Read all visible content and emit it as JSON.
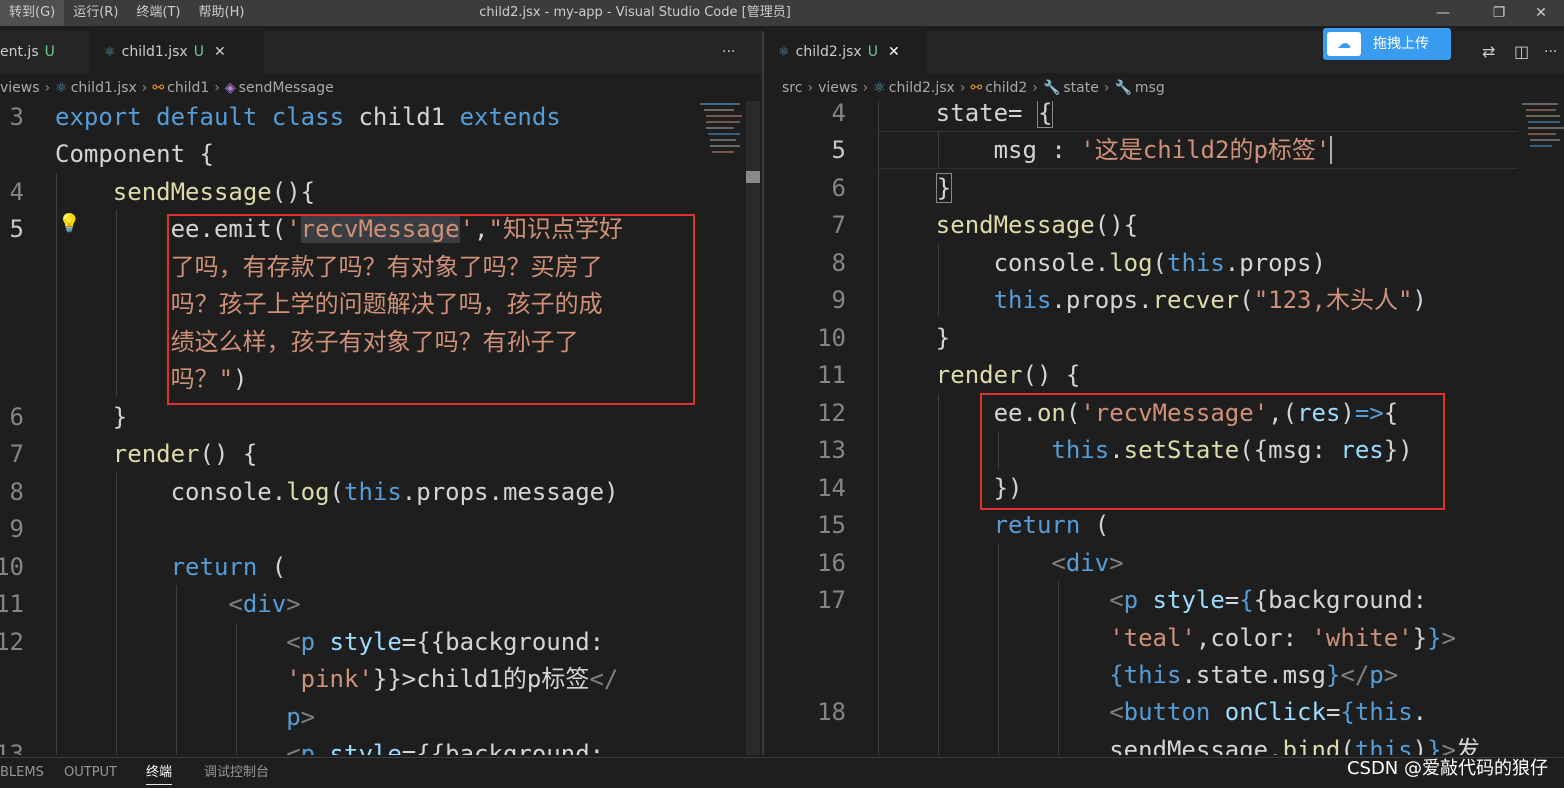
{
  "window": {
    "menu": [
      "转到(G)",
      "运行(R)",
      "终端(T)",
      "帮助(H)"
    ],
    "title": "child2.jsx - my-app - Visual Studio Code [管理员]",
    "controls": [
      "—",
      "❐",
      "✕"
    ]
  },
  "left_pane": {
    "tabs": [
      {
        "label": "ent.js",
        "status": "U",
        "close": ""
      },
      {
        "label": "child1.jsx",
        "status": "U",
        "close": "✕"
      }
    ],
    "more": "···",
    "breadcrumbs": [
      "views",
      "child1.jsx",
      "child1",
      "sendMessage"
    ],
    "line_numbers": [
      "3",
      "",
      "4",
      "5",
      "",
      "",
      "",
      "",
      "6",
      "7",
      "8",
      "9",
      "10",
      "11",
      "12",
      "",
      "",
      "13"
    ]
  },
  "right_pane": {
    "tabs": [
      {
        "label": "child2.jsx",
        "status": "U",
        "close": "✕"
      }
    ],
    "breadcrumbs": [
      "src",
      "views",
      "child2.jsx",
      "child2",
      "state",
      "msg"
    ],
    "line_numbers": [
      "4",
      "5",
      "6",
      "7",
      "8",
      "9",
      "10",
      "11",
      "12",
      "13",
      "14",
      "15",
      "16",
      "17",
      "",
      "",
      "18",
      ""
    ]
  },
  "upload_button": {
    "label": "拖拽上传"
  },
  "panel": {
    "tabs": [
      "BLEMS",
      "OUTPUT",
      "终端",
      "调试控制台"
    ],
    "active": "终端"
  },
  "watermark": "CSDN @爱敲代码的狼仔",
  "colors": {
    "background": "#1e1e1e",
    "titlebar": "#3c3c3c",
    "keyword": "#569cd6",
    "string": "#ce9178",
    "highlight_box": "#e03131",
    "untracked": "#73c991"
  }
}
